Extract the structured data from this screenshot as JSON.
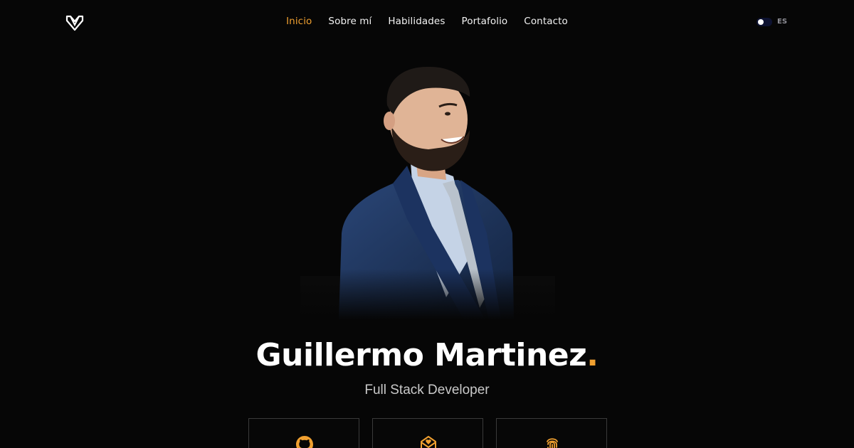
{
  "nav": {
    "logo_icon": "gm-monogram-logo",
    "items": [
      {
        "label": "Inicio",
        "active": true
      },
      {
        "label": "Sobre mí",
        "active": false
      },
      {
        "label": "Habilidades",
        "active": false
      },
      {
        "label": "Portafolio",
        "active": false
      },
      {
        "label": "Contacto",
        "active": false
      }
    ],
    "theme_toggle_state": "dark",
    "language": "ES"
  },
  "hero": {
    "name": "Guillermo Martinez",
    "name_accent": ".",
    "role": "Full Stack Developer",
    "portrait": "portrait-photo"
  },
  "cards": [
    {
      "icon": "github-icon"
    },
    {
      "icon": "mail-heart-icon"
    },
    {
      "icon": "fingerprint-icon"
    }
  ],
  "colors": {
    "background": "#060606",
    "accent": "#f0a030",
    "text": "#ffffff",
    "muted": "#c9c9c9"
  }
}
